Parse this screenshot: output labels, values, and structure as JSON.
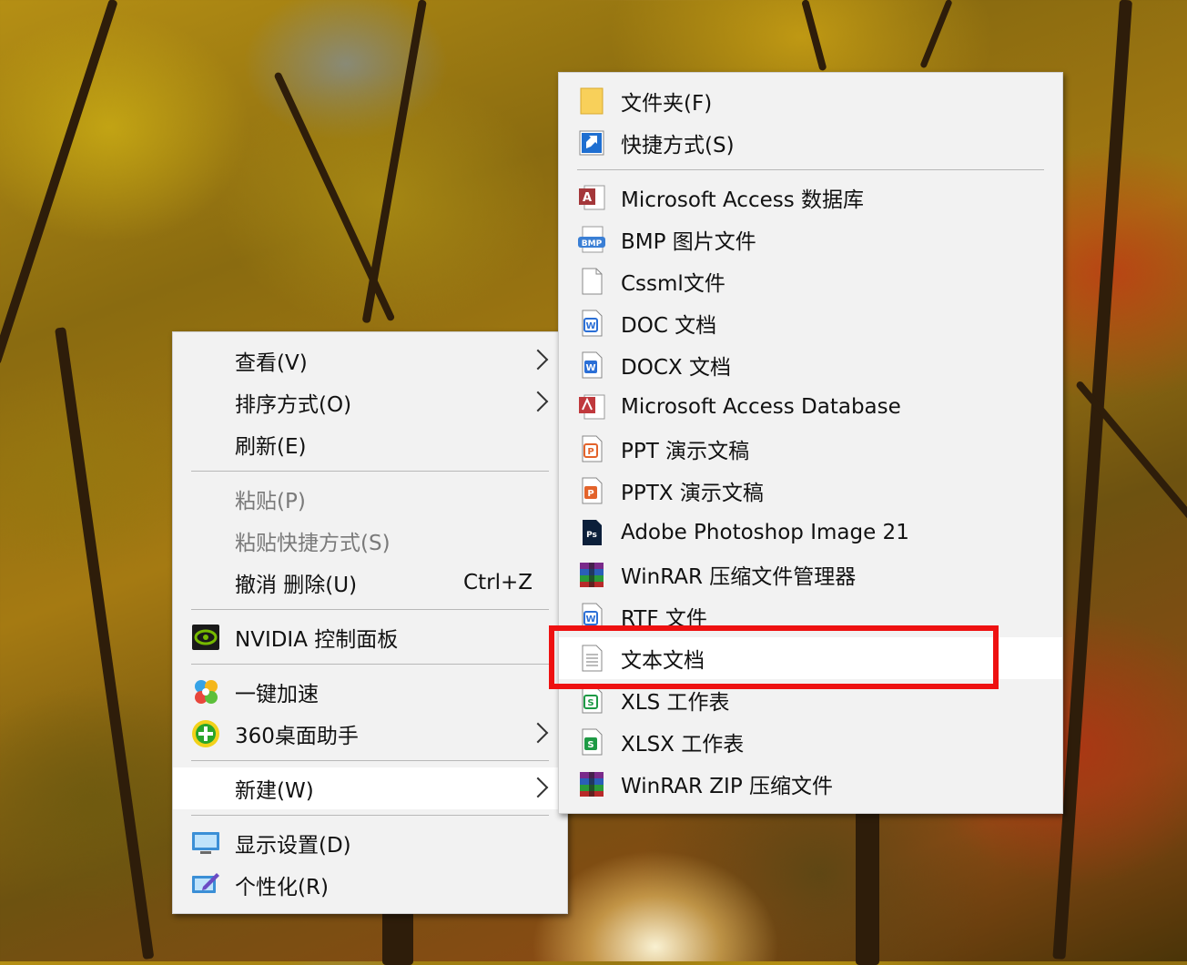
{
  "context_menu": {
    "items": [
      {
        "label": "查看(V)",
        "has_submenu": true
      },
      {
        "label": "排序方式(O)",
        "has_submenu": true
      },
      {
        "label": "刷新(E)"
      },
      {
        "label": "粘贴(P)",
        "disabled": true
      },
      {
        "label": "粘贴快捷方式(S)",
        "disabled": true
      },
      {
        "label": "撤消 删除(U)",
        "shortcut": "Ctrl+Z"
      },
      {
        "label": "NVIDIA 控制面板",
        "icon": "nvidia-icon"
      },
      {
        "label": "一键加速",
        "icon": "speedup-icon"
      },
      {
        "label": "360桌面助手",
        "icon": "360-desktop-icon",
        "has_submenu": true
      },
      {
        "label": "新建(W)",
        "has_submenu": true,
        "state": "hover"
      },
      {
        "label": "显示设置(D)",
        "icon": "display-settings-icon"
      },
      {
        "label": "个性化(R)",
        "icon": "personalize-icon"
      }
    ]
  },
  "new_submenu": {
    "items": [
      {
        "label": "文件夹(F)",
        "icon": "folder-icon"
      },
      {
        "label": "快捷方式(S)",
        "icon": "shortcut-icon"
      },
      {
        "label": "Microsoft Access 数据库",
        "icon": "access-db-icon"
      },
      {
        "label": "BMP 图片文件",
        "icon": "bmp-icon"
      },
      {
        "label": "Cssml文件",
        "icon": "blank-file-icon"
      },
      {
        "label": "DOC 文档",
        "icon": "doc-icon"
      },
      {
        "label": "DOCX 文档",
        "icon": "docx-icon"
      },
      {
        "label": "Microsoft Access Database",
        "icon": "access-database-icon"
      },
      {
        "label": "PPT 演示文稿",
        "icon": "ppt-icon"
      },
      {
        "label": "PPTX 演示文稿",
        "icon": "pptx-icon"
      },
      {
        "label": "Adobe Photoshop Image 21",
        "icon": "photoshop-icon"
      },
      {
        "label": "WinRAR 压缩文件管理器",
        "icon": "winrar-icon"
      },
      {
        "label": "RTF 文件",
        "icon": "rtf-icon"
      },
      {
        "label": "文本文档",
        "icon": "text-document-icon",
        "state": "highlighted"
      },
      {
        "label": "XLS 工作表",
        "icon": "xls-icon"
      },
      {
        "label": "XLSX 工作表",
        "icon": "xlsx-icon"
      },
      {
        "label": "WinRAR ZIP 压缩文件",
        "icon": "winrar-zip-icon"
      }
    ]
  },
  "colors": {
    "menu_background": "#f2f2f2",
    "hover_background": "#ffffff",
    "annotation_box": "#ee1111",
    "disabled_text": "#7a7a7a"
  }
}
